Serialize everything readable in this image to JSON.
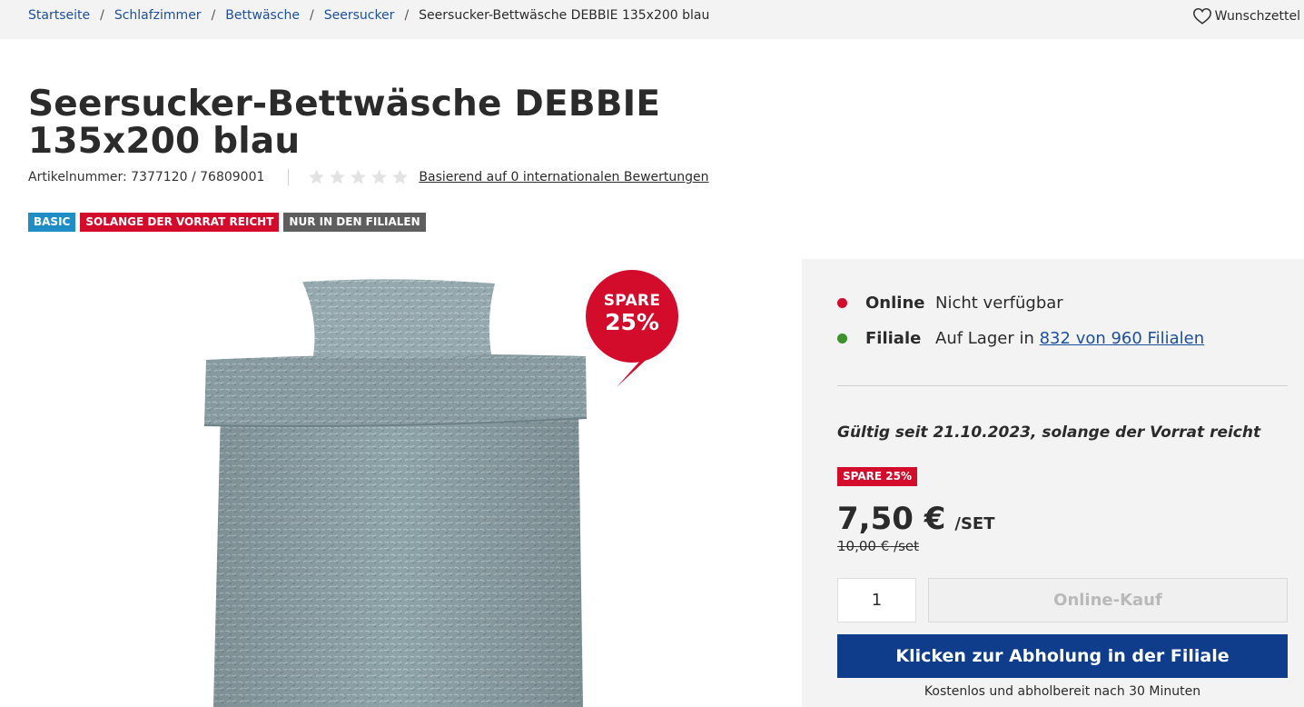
{
  "breadcrumb": {
    "items": [
      "Startseite",
      "Schlafzimmer",
      "Bettwäsche",
      "Seersucker"
    ],
    "separator": "/",
    "current": "Seersucker-Bettwäsche DEBBIE 135x200 blau"
  },
  "header": {
    "wishlist_label": "Wunschzettel",
    "wishlist_icon": "heart-outline-icon"
  },
  "product": {
    "title": "Seersucker-Bettwäsche DEBBIE 135x200 blau",
    "article_label": "Artikelnummer: 7377120",
    "article_sep": "/",
    "article_variant": "76809001",
    "rating": {
      "value": 0,
      "max": 5,
      "icon": "star-icon"
    },
    "reviews_label": "Basierend auf 0 internationalen Bewertungen",
    "badges": [
      "BASIC",
      "SOLANGE DER VORRAT REICHT",
      "NUR IN DEN FILIALEN"
    ],
    "image_bubble": {
      "line1": "SPARE",
      "line2": "25%"
    }
  },
  "availability": {
    "online": {
      "label": "Online",
      "value": "Nicht verfügbar",
      "status_color": "#d30c2c"
    },
    "store": {
      "label": "Filiale",
      "value_prefix": "Auf Lager in",
      "value_link": "832 von 960 Filialen",
      "status_color": "#3e8f2e"
    }
  },
  "offer": {
    "validity": "Gültig seit 21.10.2023, solange der Vorrat reicht",
    "save_badge": "SPARE 25%",
    "price": "7,50 €",
    "price_unit": "/SET",
    "old_price": "10,00 € /set"
  },
  "purchase": {
    "quantity": "1",
    "online_button": "Online-Kauf",
    "pickup_button": "Klicken zur Abholung in der Filiale",
    "pickup_note": "Kostenlos und abholbereit nach 30 Minuten"
  },
  "colors": {
    "accent_blue": "#0f3d8c",
    "link_blue": "#1d4f9c",
    "sale_red": "#d30c2c",
    "basic_blue": "#1f8dc6",
    "in_stock_green": "#3e8f2e"
  }
}
